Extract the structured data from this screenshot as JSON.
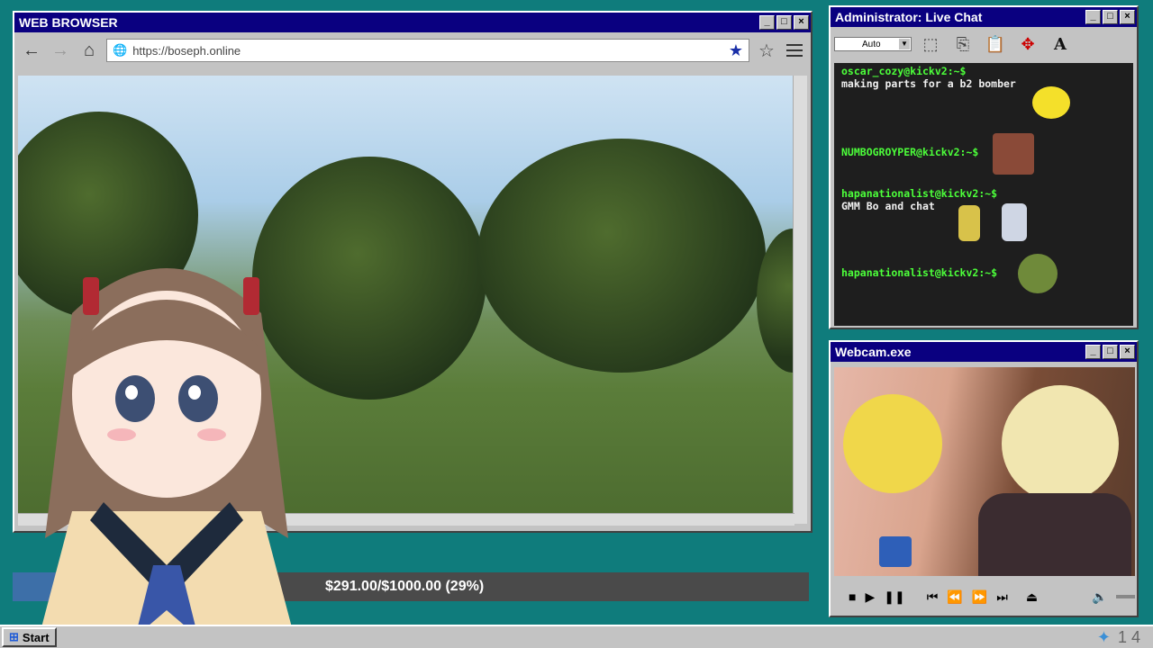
{
  "browser": {
    "title": "WEB BROWSER",
    "url": "https://boseph.online",
    "back_icon": "arrow-left-icon",
    "forward_icon": "arrow-right-icon",
    "home_icon": "home-icon"
  },
  "chat": {
    "title": "Administrator: Live Chat",
    "zoom": "Auto",
    "messages": [
      {
        "user": "oscar_cozy@kickv2:~$",
        "text": "making parts for a b2 bomber"
      },
      {
        "user": "NUMBOGROYPER@kickv2:~$",
        "text": ""
      },
      {
        "user": "hapanationalist@kickv2:~$",
        "text": "GMM Bo and chat"
      },
      {
        "user": "hapanationalist@kickv2:~$",
        "text": ""
      }
    ]
  },
  "webcam": {
    "title": "Webcam.exe"
  },
  "donation": {
    "label": "$291.00/$1000.00 (29%)",
    "progress": 0.29
  },
  "taskbar": {
    "start_label": "Start",
    "clock": "1 4"
  },
  "colors": {
    "desktop": "#0f7c7c",
    "titlebar": "#0a0080",
    "chat_user": "#4cff3a"
  }
}
